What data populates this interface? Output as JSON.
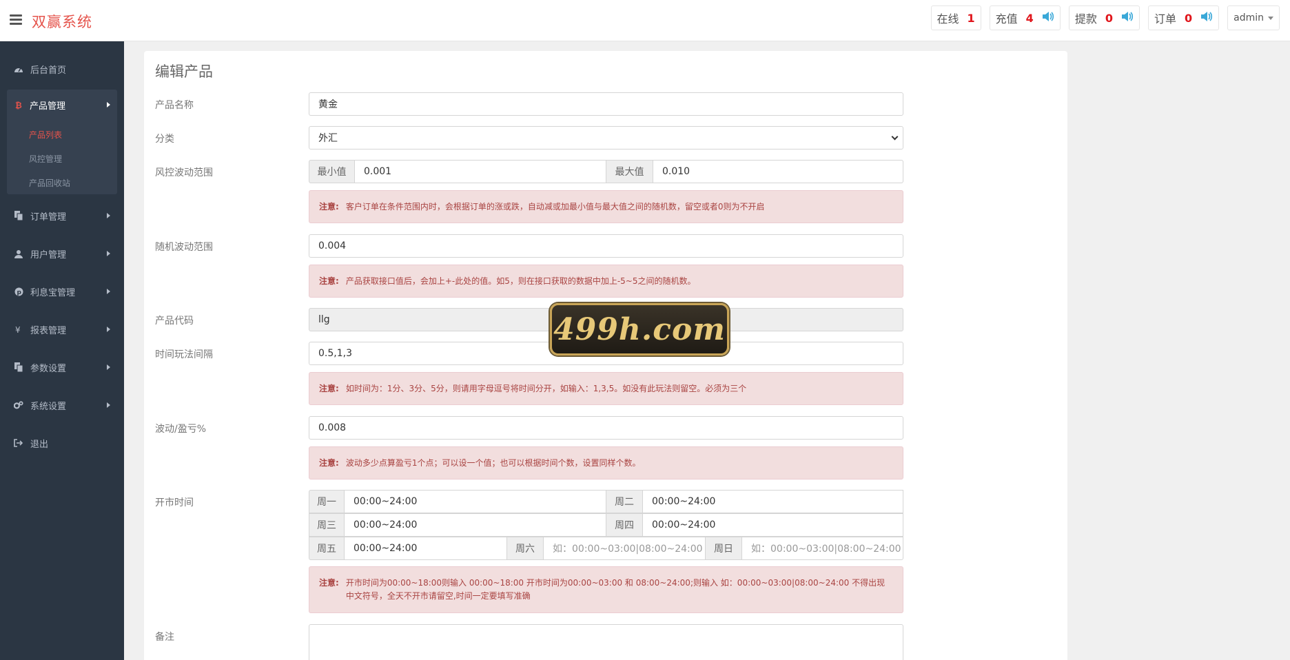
{
  "header": {
    "brand": "双赢系统",
    "online_label": "在线",
    "online_count": "1",
    "recharge_label": "充值",
    "recharge_count": "4",
    "withdraw_label": "提款",
    "withdraw_count": "0",
    "order_label": "订单",
    "order_count": "0",
    "user": "admin"
  },
  "sidebar": {
    "items": [
      {
        "label": "后台首页",
        "icon": "dashboard-icon"
      },
      {
        "label": "订单管理",
        "icon": "copy-icon"
      },
      {
        "label": "用户管理",
        "icon": "user-icon"
      },
      {
        "label": "利息宝管理",
        "icon": "pinterest-icon"
      },
      {
        "label": "报表管理",
        "icon": "yen-icon"
      },
      {
        "label": "参数设置",
        "icon": "copy-icon"
      },
      {
        "label": "系统设置",
        "icon": "gears-icon"
      },
      {
        "label": "退出",
        "icon": "sign-out-icon"
      }
    ],
    "product_group": {
      "label": "产品管理",
      "subitems": [
        "产品列表",
        "风控管理",
        "产品回收站"
      ]
    }
  },
  "form": {
    "title": "编辑产品",
    "name_label": "产品名称",
    "name_value": "黄金",
    "category_label": "分类",
    "category_value": "外汇",
    "risk_label": "风控波动范围",
    "risk_min_label": "最小值",
    "risk_min_value": "0.001",
    "risk_max_label": "最大值",
    "risk_max_value": "0.010",
    "notice_label": "注意:",
    "risk_note": "客户订单在条件范围内时，会根据订单的涨或跌，自动减或加最小值与最大值之间的随机数，留空或者0则为不开启",
    "random_label": "随机波动范围",
    "random_value": "0.004",
    "random_note": "产品获取接口值后，会加上+-此处的值。如5，则在接口获取的数据中加上-5~5之间的随机数。",
    "code_label": "产品代码",
    "code_value": "llg",
    "interval_label": "时间玩法间隔",
    "interval_value": "0.5,1,3",
    "interval_note": "如时间为：1分、3分、5分，则请用字母逗号将时间分开，如输入：1,3,5。如没有此玩法则留空。必须为三个",
    "wave_label": "波动/盈亏%",
    "wave_value": "0.008",
    "wave_note": "波动多少点算盈亏1个点；可以设一个值；也可以根据时间个数，设置同样个数。",
    "open_label": "开市时间",
    "days": {
      "mon": "周一",
      "tue": "周二",
      "wed": "周三",
      "thu": "周四",
      "fri": "周五",
      "sat": "周六",
      "sun": "周日"
    },
    "times": {
      "mon": "00:00~24:00",
      "tue": "00:00~24:00",
      "wed": "00:00~24:00",
      "thu": "00:00~24:00",
      "fri": "00:00~24:00"
    },
    "weekend_placeholder": "如：00:00~03:00|08:00~24:00",
    "open_note": "开市时间为00:00~18:00则输入 00:00~18:00 开市时间为00:00~03:00 和 08:00~24:00;则输入 如：00:00~03:00|08:00~24:00 不得出现中文符号，全天不开市请留空,时间一定要填写准确",
    "remark_label": "备注"
  },
  "watermark": "499h.com",
  "colors": {
    "brand": "#e5534b",
    "sidebar_bg": "#2b3643",
    "alert_bg": "#f2dede",
    "alert_text": "#a94442",
    "speaker": "#3aa8d8"
  }
}
